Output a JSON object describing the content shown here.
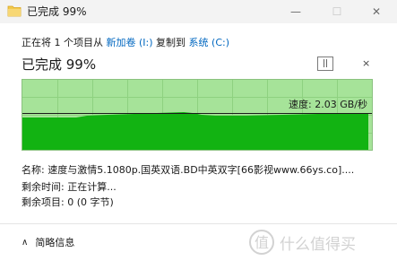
{
  "window": {
    "title": "已完成 99%",
    "buttons": {
      "minimize": "—",
      "maximize": "☐",
      "close": "✕"
    }
  },
  "header": {
    "copy_prefix": "正在将 1 个项目从 ",
    "source": "新加卷 (I:)",
    "copy_middle": " 复制到 ",
    "destination": "系统 (C:)",
    "progress_title": "已完成 99%",
    "pause_label": "||",
    "cancel_label": "×"
  },
  "graph": {
    "speed_text": "速度: 2.03 GB/秒",
    "progress_percent": 99,
    "colors": {
      "background": "#a6e399",
      "fill": "#12b312",
      "grid": "#8ed180"
    }
  },
  "details": {
    "name": "名称: 速度与激情5.1080p.国英双语.BD中英双字[66影视www.66ys.co]....",
    "time_remaining": "剩余时间: 正在计算...",
    "items_remaining": "剩余项目: 0 (0 字节)"
  },
  "footer": {
    "less_details_label": "简略信息",
    "chevron": "∧"
  },
  "watermark": {
    "text": "什么值得买"
  }
}
